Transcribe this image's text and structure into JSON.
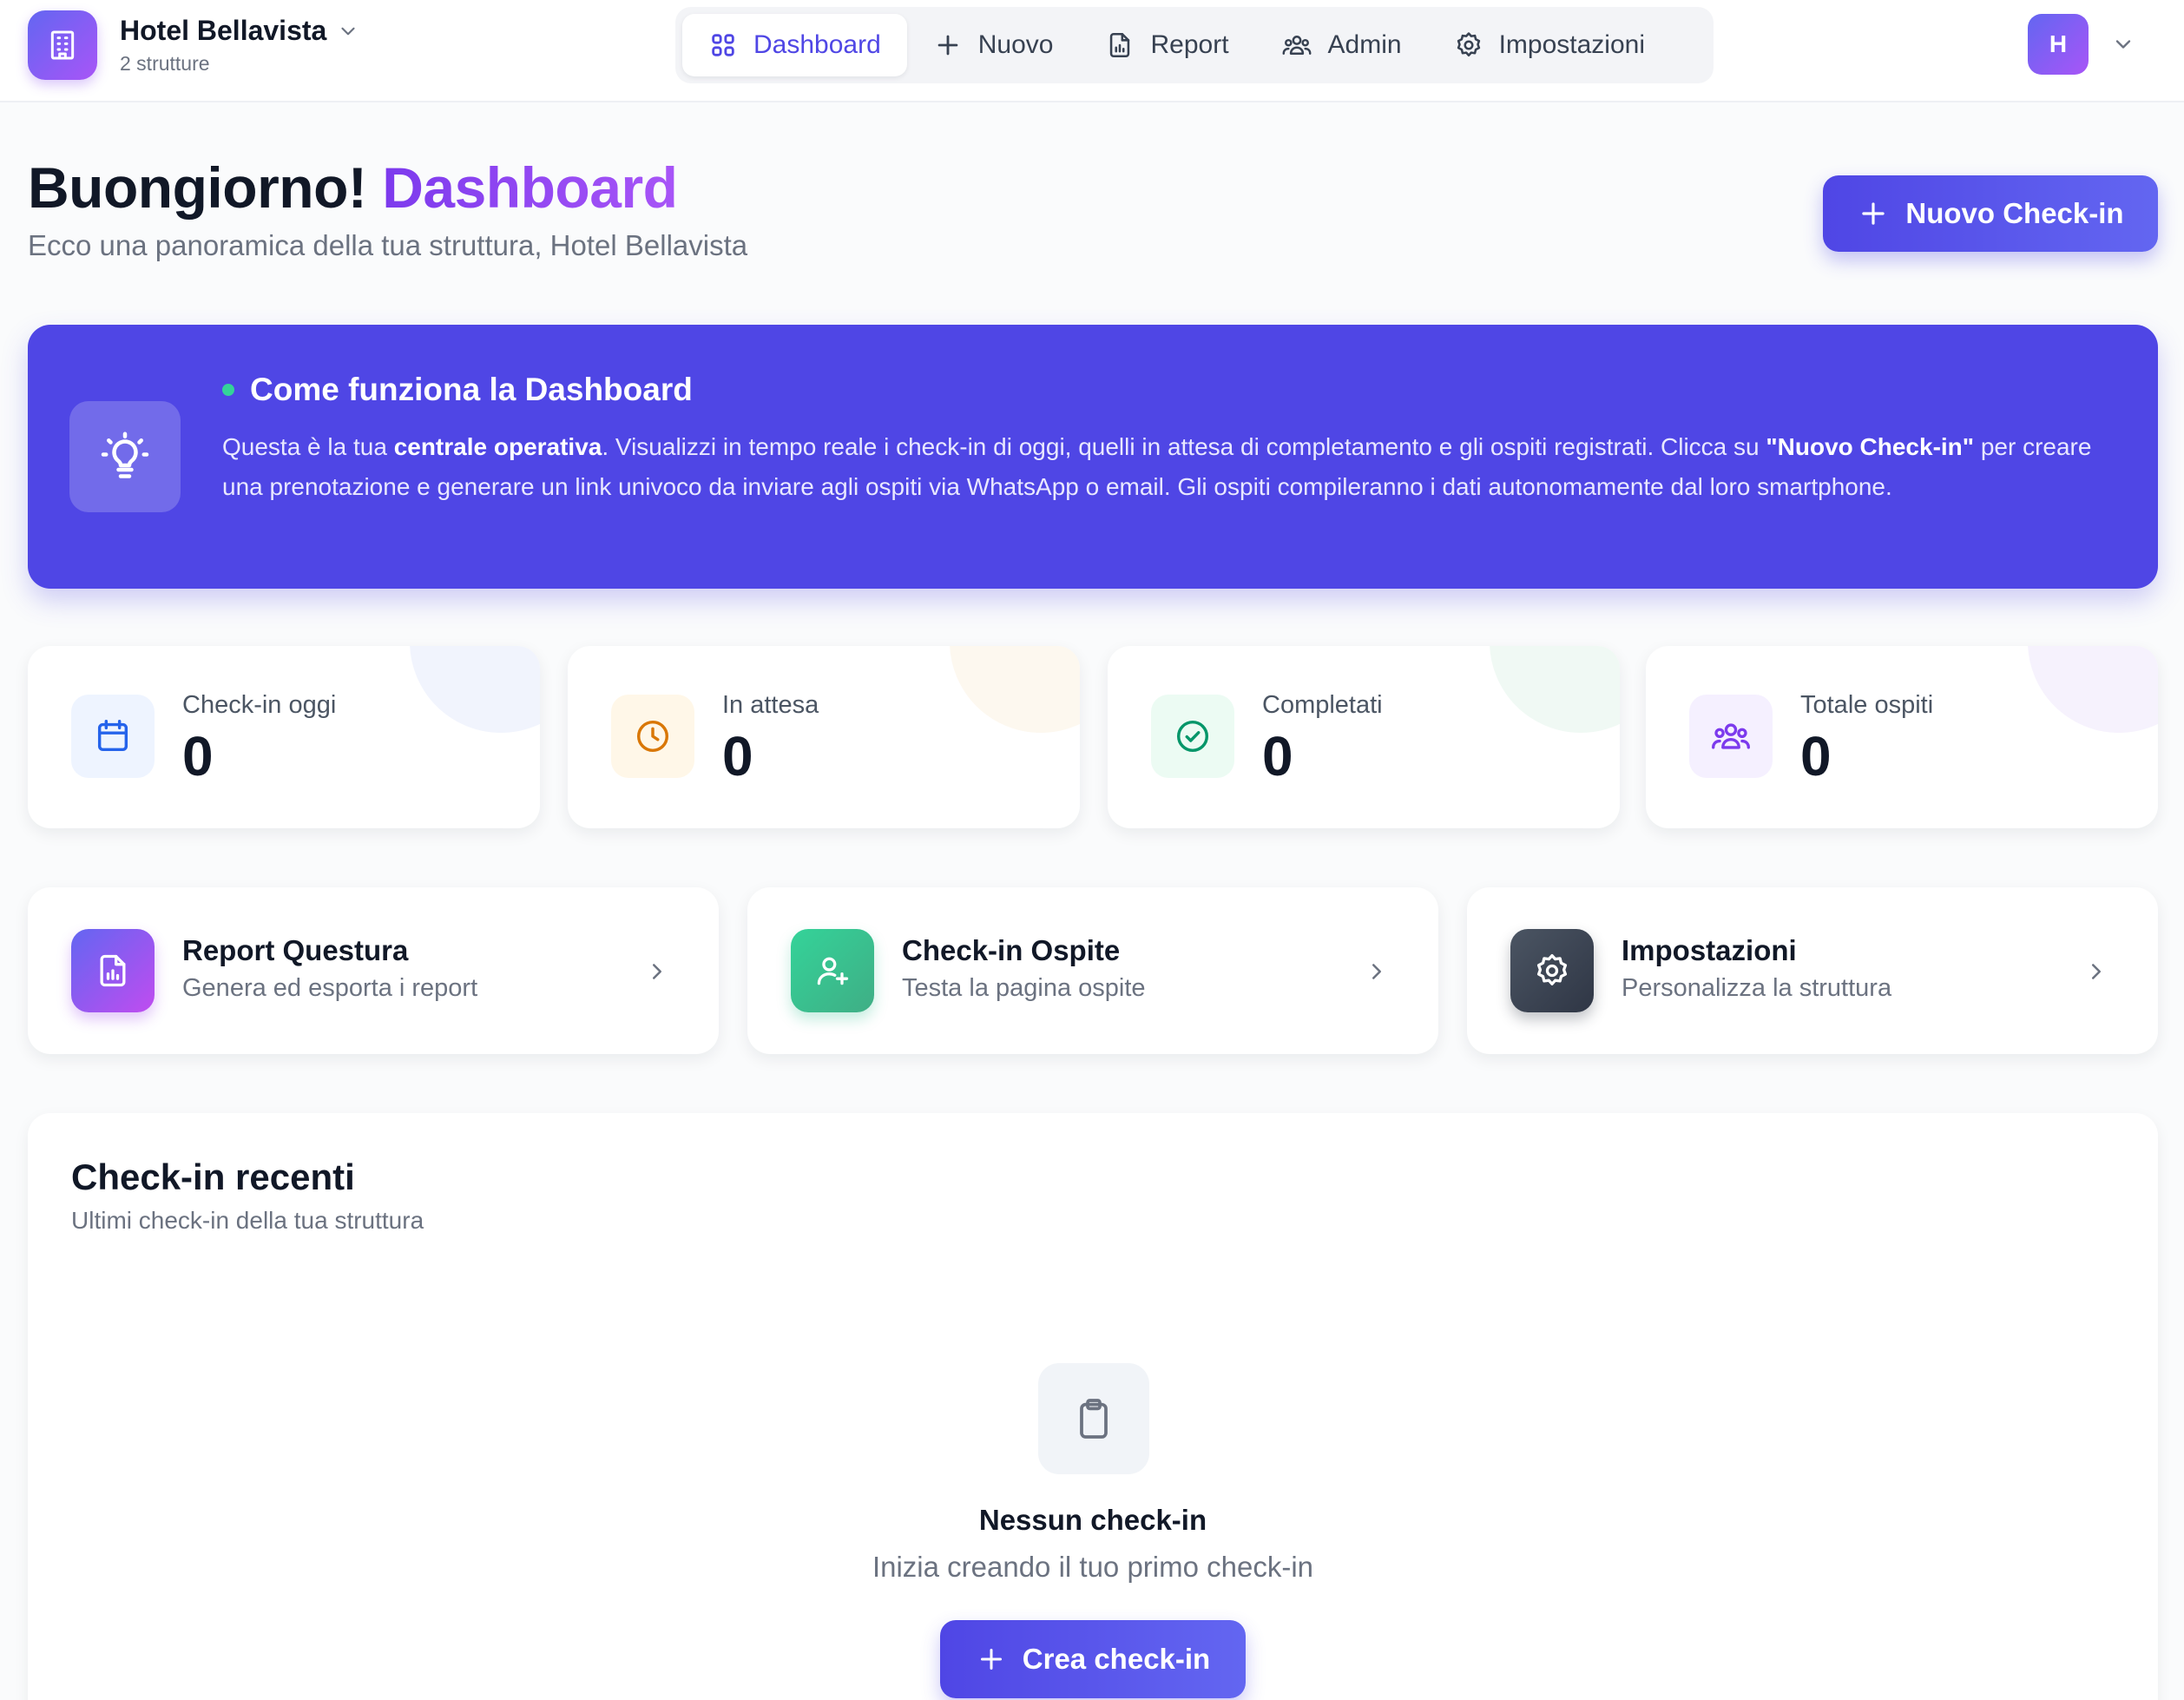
{
  "brand": {
    "name": "Hotel Bellavista",
    "subtitle": "2 strutture",
    "logo_icon": "building-icon"
  },
  "nav": {
    "items": [
      {
        "label": "Dashboard",
        "icon": "grid-icon",
        "active": true
      },
      {
        "label": "Nuovo",
        "icon": "plus-icon",
        "active": false
      },
      {
        "label": "Report",
        "icon": "report-file-icon",
        "active": false
      },
      {
        "label": "Admin",
        "icon": "users-icon",
        "active": false
      },
      {
        "label": "Impostazioni",
        "icon": "gear-icon",
        "active": false
      }
    ]
  },
  "user": {
    "initial": "H"
  },
  "header": {
    "greeting": "Buongiorno!",
    "greeting_accent": "Dashboard",
    "subtitle": "Ecco una panoramica della tua struttura, Hotel Bellavista",
    "primary_button": "Nuovo Check-in"
  },
  "info": {
    "title": "Come funziona la Dashboard",
    "text_1": "Questa è la tua ",
    "text_bold_1": "centrale operativa",
    "text_2": ". Visualizzi in tempo reale i check-in di oggi, quelli in attesa di completamento e gli ospiti registrati. Clicca su ",
    "text_bold_2": "\"Nuovo Check-in\"",
    "text_3": " per creare una prenotazione e generare un link univoco da inviare agli ospiti via WhatsApp o email. Gli ospiti compileranno i dati autonomamente dal loro smartphone."
  },
  "stats": [
    {
      "label": "Check-in oggi",
      "value": "0",
      "icon": "calendar-icon",
      "color": "#2563eb",
      "bg": "#eef4ff"
    },
    {
      "label": "In attesa",
      "value": "0",
      "icon": "clock-icon",
      "color": "#d97706",
      "bg": "#fff7e8"
    },
    {
      "label": "Completati",
      "value": "0",
      "icon": "check-circle-icon",
      "color": "#059669",
      "bg": "#ecfbf3"
    },
    {
      "label": "Totale ospiti",
      "value": "0",
      "icon": "users-icon",
      "color": "#7c3aed",
      "bg": "#f5f0ff"
    }
  ],
  "actions": [
    {
      "title": "Report Questura",
      "subtitle": "Genera ed esporta i report",
      "icon": "report-file-icon"
    },
    {
      "title": "Check-in Ospite",
      "subtitle": "Testa la pagina ospite",
      "icon": "user-plus-icon"
    },
    {
      "title": "Impostazioni",
      "subtitle": "Personalizza la struttura",
      "icon": "gear-icon"
    }
  ],
  "recent": {
    "title": "Check-in recenti",
    "subtitle": "Ultimi check-in della tua struttura",
    "empty_title": "Nessun check-in",
    "empty_subtitle": "Inizia creando il tuo primo check-in",
    "empty_icon": "clipboard-icon",
    "button": "Crea check-in"
  },
  "colors": {
    "accent": "#4f46e5",
    "accent_purple": "#a855f7"
  }
}
